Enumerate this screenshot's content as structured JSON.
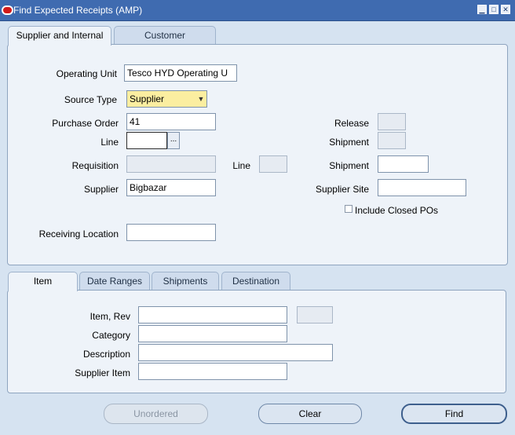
{
  "window": {
    "title": "Find Expected Receipts (AMP)"
  },
  "top_tabs": [
    {
      "label": "Supplier and Internal"
    },
    {
      "label": "Customer"
    }
  ],
  "form": {
    "operating_unit": {
      "label": "Operating Unit",
      "value": "Tesco HYD Operating U"
    },
    "source_type": {
      "label": "Source Type",
      "value": "Supplier"
    },
    "purchase_order": {
      "label": "Purchase Order",
      "value": "41"
    },
    "release": {
      "label": "Release",
      "value": ""
    },
    "line": {
      "label": "Line",
      "value": "",
      "lov_glyph": "..."
    },
    "shipment": {
      "label": "Shipment",
      "value": ""
    },
    "requisition": {
      "label": "Requisition",
      "value": ""
    },
    "req_line": {
      "label": "Line",
      "value": ""
    },
    "req_shipment": {
      "label": "Shipment",
      "value": ""
    },
    "supplier": {
      "label": "Supplier",
      "value": "Bigbazar"
    },
    "supplier_site": {
      "label": "Supplier Site",
      "value": ""
    },
    "include_closed": {
      "label": "Include Closed POs",
      "checked": false
    },
    "receiving_location": {
      "label": "Receiving Location",
      "value": ""
    }
  },
  "bottom_tabs": [
    {
      "label": "Item"
    },
    {
      "label": "Date Ranges"
    },
    {
      "label": "Shipments"
    },
    {
      "label": "Destination"
    }
  ],
  "item": {
    "item_rev": {
      "label": "Item, Rev",
      "value": "",
      "rev_value": ""
    },
    "category": {
      "label": "Category",
      "value": ""
    },
    "description": {
      "label": "Description",
      "value": ""
    },
    "supplier_item": {
      "label": "Supplier Item",
      "value": ""
    }
  },
  "buttons": {
    "unordered": {
      "label": "Unordered"
    },
    "clear": {
      "label": "Clear"
    },
    "find": {
      "label": "Find"
    }
  },
  "colors": {
    "titlebar": "#3f6bb0",
    "required_field": "#fbeea0",
    "background": "#d6e3f1"
  }
}
